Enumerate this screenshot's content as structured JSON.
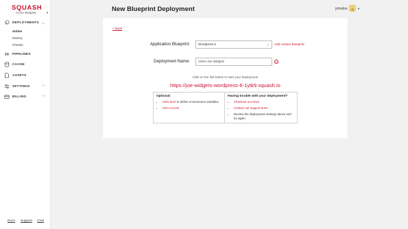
{
  "sidebar": {
    "logo": "SQUASH",
    "org": "Acme Widgets",
    "items": [
      {
        "label": "DEPLOYMENTS"
      },
      {
        "label": "PIPELINES"
      },
      {
        "label": "CACHE"
      },
      {
        "label": "ASSETS"
      },
      {
        "label": "SETTINGS"
      },
      {
        "label": "BILLING"
      }
    ],
    "sub_items": [
      {
        "label": "Active"
      },
      {
        "label": "History"
      },
      {
        "label": "Checks"
      }
    ],
    "footer": [
      "Docs",
      "Support",
      "Chat"
    ]
  },
  "header": {
    "title": "New Blueprint Deployment",
    "username": "johndoe"
  },
  "form": {
    "back_label": "< Back",
    "blueprint_label": "Application Blueprint:",
    "blueprint_value": "Wordpress 6",
    "add_custom_label": "Add custom Blueprint",
    "name_label": "Deployment Name:",
    "name_value": "Client Joe Widgets",
    "help_glyph": "?",
    "hint": "Click on the link below to start your deployment",
    "url": "https://joe-widgets-wordpress-6-1ytk9.squash.io"
  },
  "optional": {
    "title": "Optional:",
    "items": [
      {
        "link": "Click here",
        "rest": " to define environment variables"
      },
      {
        "link": "SSH Access",
        "rest": ""
      }
    ]
  },
  "trouble": {
    "title": "Having trouble with your deployment?",
    "items": [
      {
        "link": "Checkout our Docs",
        "rest": ""
      },
      {
        "link": "Contact our support team",
        "rest": ""
      },
      {
        "link": "",
        "rest": "Review the deployment settings above and try again"
      }
    ]
  },
  "colors": {
    "accent": "#c8102e",
    "background": "#f1f1f2"
  }
}
